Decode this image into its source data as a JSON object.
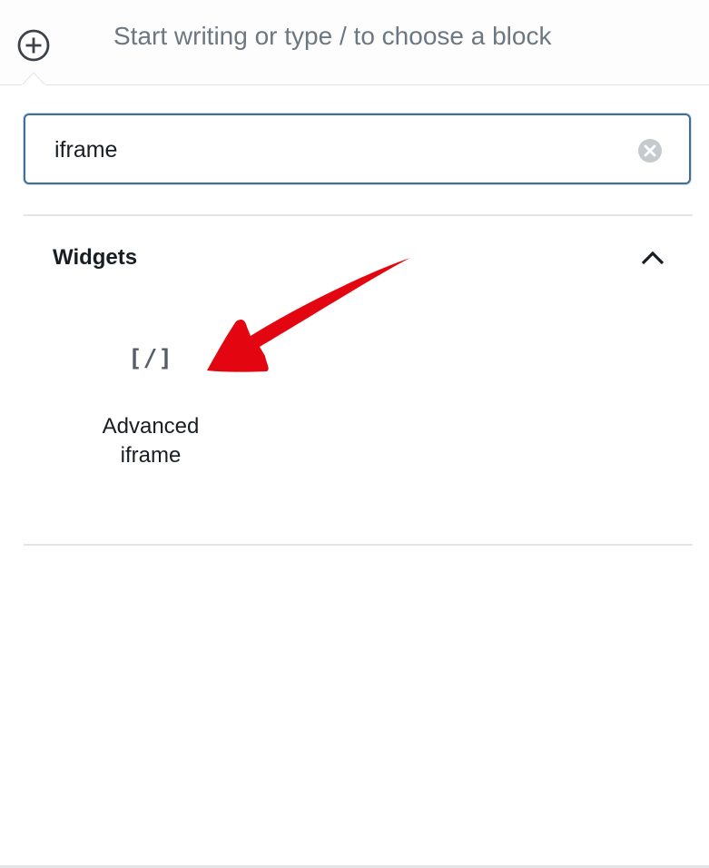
{
  "editor": {
    "placeholder": "Start writing or type / to choose a block"
  },
  "inserter": {
    "search": {
      "value": "iframe"
    },
    "panel": {
      "title": "Widgets"
    },
    "blocks": [
      {
        "icon_text": "[/]",
        "label_line1": "Advanced",
        "label_line2": "iframe",
        "icon": "shortcode-icon"
      }
    ]
  },
  "annotation": {
    "arrow_color": "#e3050f"
  }
}
